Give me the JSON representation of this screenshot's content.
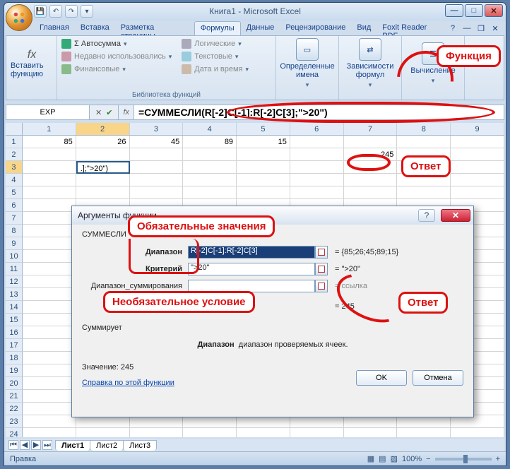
{
  "title": "Книга1 - Microsoft Excel",
  "tabs": [
    "Главная",
    "Вставка",
    "Разметка страницы",
    "Формулы",
    "Данные",
    "Рецензирование",
    "Вид",
    "Foxit Reader PDF"
  ],
  "active_tab": 3,
  "ribbon": {
    "insert_fn_top": "fx",
    "insert_fn": "Вставить функцию",
    "lib_title": "Библиотека функций",
    "items_left": [
      "Автосумма",
      "Недавно использовались",
      "Финансовые"
    ],
    "items_right": [
      "Логические",
      "Текстовые",
      "Дата и время"
    ],
    "defined_names": "Определенные имена",
    "deps": "Зависимости формул",
    "calc": "Вычисление"
  },
  "annotations": {
    "function": "Функция",
    "answer": "Ответ",
    "required": "Обязательные значения",
    "optional": "Необязательное условие",
    "dlg_answer": "Ответ"
  },
  "namebox": "EXP",
  "formula": "=СУММЕСЛИ(R[-2]C[-1]:R[-2]C[3];\">20\")",
  "columns": [
    "1",
    "2",
    "3",
    "4",
    "5",
    "6",
    "7",
    "8",
    "9"
  ],
  "rows": {
    "1": [
      "85",
      "26",
      "45",
      "89",
      "15",
      "",
      "",
      "",
      ""
    ],
    "2": [
      "",
      "",
      "",
      "",
      "",
      "",
      "245",
      "",
      ""
    ],
    "3": [
      "",
      ".];\">20\")",
      "",
      "",
      "",
      "",
      "",
      "",
      ""
    ]
  },
  "row_count": 24,
  "dialog": {
    "title": "Аргументы функции",
    "fn_name": "СУММЕСЛИ",
    "args": [
      {
        "label": "Диапазон",
        "value": "R[-2]C[-1]:R[-2]C[3]",
        "result": "= {85;26;45;89;15}",
        "sel": true
      },
      {
        "label": "Критерий",
        "value": "\">20\"",
        "result": "= \">20\""
      },
      {
        "label": "Диапазон_суммирования",
        "value": "",
        "result": "= ссылка",
        "optional": true
      }
    ],
    "calc_eq": "= 245",
    "desc_lead": "Суммирует",
    "desc_bold": "Диапазон",
    "desc_rest": "диапазон проверяемых ячеек.",
    "value_label": "Значение:",
    "value": "245",
    "help_link": "Справка по этой функции",
    "ok": "OK",
    "cancel": "Отмена"
  },
  "sheets": [
    "Лист1",
    "Лист2",
    "Лист3"
  ],
  "status": "Правка",
  "zoom": "100%"
}
